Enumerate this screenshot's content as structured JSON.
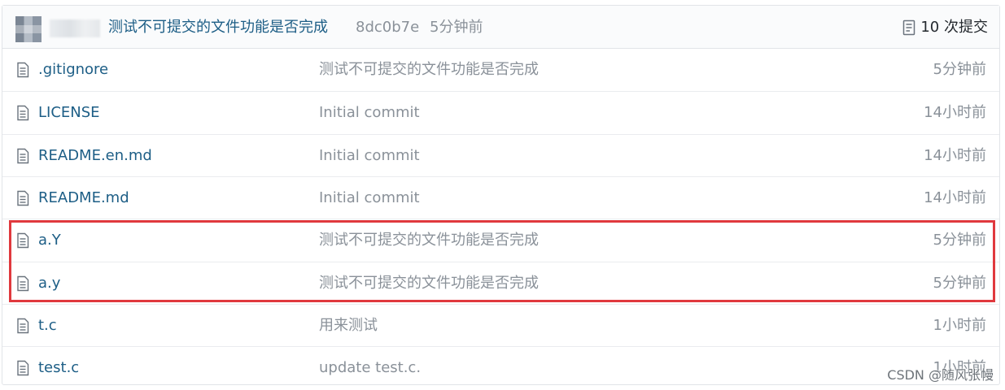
{
  "last_commit": {
    "message": "测试不可提交的文件功能是否完成",
    "sha": "8dc0b7e",
    "time": "5分钟前",
    "commits_label": "10 次提交"
  },
  "files": [
    {
      "name": ".gitignore",
      "message": "测试不可提交的文件功能是否完成",
      "age": "5分钟前"
    },
    {
      "name": "LICENSE",
      "message": "Initial commit",
      "age": "14小时前"
    },
    {
      "name": "README.en.md",
      "message": "Initial commit",
      "age": "14小时前"
    },
    {
      "name": "README.md",
      "message": "Initial commit",
      "age": "14小时前"
    },
    {
      "name": "a.Y",
      "message": "测试不可提交的文件功能是否完成",
      "age": "5分钟前"
    },
    {
      "name": "a.y",
      "message": "测试不可提交的文件功能是否完成",
      "age": "5分钟前"
    },
    {
      "name": "t.c",
      "message": "用来测试",
      "age": "1小时前"
    },
    {
      "name": "test.c",
      "message": "update test.c.",
      "age": "1小时前"
    }
  ],
  "icons": {
    "file": "file-text-icon",
    "history": "history-icon"
  },
  "colors": {
    "link": "#1d5e86",
    "muted": "#8a9199",
    "highlight_border": "#e0393e"
  },
  "watermark": "CSDN @随风张幔"
}
